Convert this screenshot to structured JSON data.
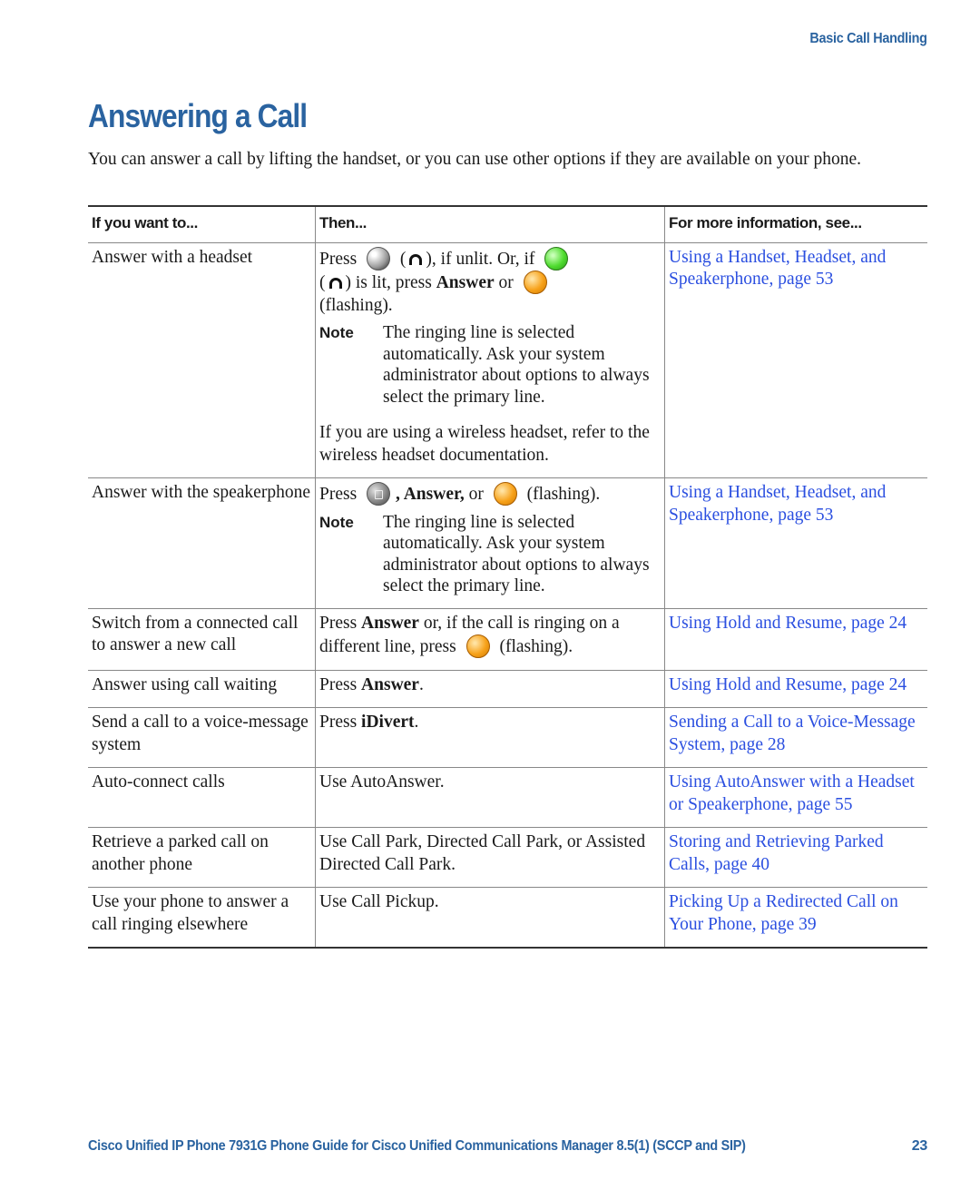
{
  "section_header": "Basic Call Handling",
  "title": "Answering a Call",
  "intro": "You can answer a call by lifting the handset, or you can use other options if they are available on your phone.",
  "table": {
    "headers": [
      "If you want to...",
      "Then...",
      "For more information, see..."
    ],
    "rows": [
      {
        "want": "Answer with a headset",
        "then": {
          "press": "Press",
          "part1": "), if unlit. Or, if",
          "part2": ") is lit, press",
          "answer": "Answer",
          "or": "or",
          "flashing": "(flashing).",
          "note_label": "Note",
          "note": "The ringing line is selected automatically. Ask your system administrator about options to always select the primary line.",
          "para": "If you are using a wireless headset, refer to the wireless headset documentation."
        },
        "see": "Using a Handset, Headset, and Speakerphone, page 53"
      },
      {
        "want": "Answer with the speakerphone",
        "then": {
          "press": "Press",
          "answer": ", Answer,",
          "or": "or",
          "flashing": "(flashing).",
          "note_label": "Note",
          "note": "The ringing line is selected automatically. Ask your system administrator about options to always select the primary line."
        },
        "see": "Using a Handset, Headset, and Speakerphone, page 53"
      },
      {
        "want": "Switch from a connected call to answer a new call",
        "then": {
          "press": "Press",
          "answer": "Answer",
          "text": "or, if the call is ringing on a different line, press",
          "flashing": "(flashing)."
        },
        "see": "Using Hold and Resume, page 24"
      },
      {
        "want": "Answer using call waiting",
        "then": {
          "press": "Press",
          "answer": "Answer",
          "end": "."
        },
        "see": "Using Hold and Resume, page 24"
      },
      {
        "want": "Send a call to a voice-message system",
        "then": {
          "press": "Press",
          "answer": "iDivert",
          "end": "."
        },
        "see": "Sending a Call to a Voice-Message System, page 28"
      },
      {
        "want": "Auto-connect calls",
        "then": {
          "text": "Use AutoAnswer."
        },
        "see": "Using AutoAnswer with a Headset or Speakerphone, page 55"
      },
      {
        "want": "Retrieve a parked call on another phone",
        "then": {
          "text": "Use Call Park, Directed Call Park, or Assisted Directed Call Park."
        },
        "see": "Storing and Retrieving Parked Calls, page 40"
      },
      {
        "want": "Use your phone to answer a call ringing elsewhere",
        "then": {
          "text": "Use Call Pickup."
        },
        "see": "Picking Up a Redirected Call on Your Phone, page 39"
      }
    ]
  },
  "footer": {
    "title": "Cisco Unified IP Phone 7931G Phone Guide for Cisco Unified Communications Manager 8.5(1) (SCCP and SIP)",
    "page": "23"
  }
}
